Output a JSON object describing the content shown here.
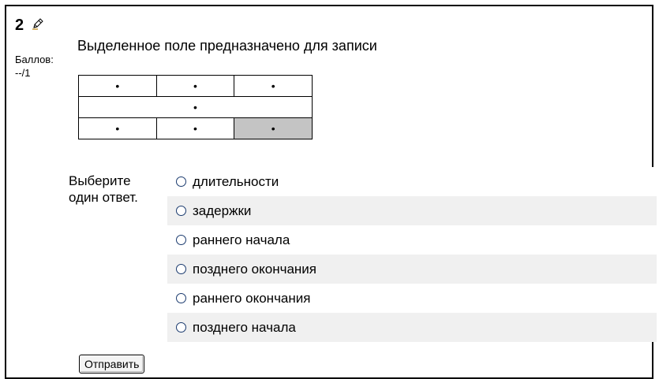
{
  "question": {
    "number": "2",
    "edit_icon": "pencil-edit-icon",
    "grade_label": "Баллов:",
    "grade_value": "--/1",
    "text": "Выделенное поле предназначено для записи"
  },
  "network_table": {
    "rows": [
      [
        "•",
        "•",
        "•"
      ],
      [
        "•"
      ],
      [
        "•",
        "•",
        "•"
      ]
    ],
    "highlighted_cell": "row 3, column 3",
    "highlight_color": "#c4c4c4"
  },
  "answer": {
    "prompt_line1": "Выберите",
    "prompt_line2": "один ответ.",
    "options": [
      "длительности",
      "задержки",
      "раннего начала",
      "позднего окончания",
      "раннего окончания",
      "позднего начала"
    ]
  },
  "submit_label": "Отправить",
  "colors": {
    "alt_row_background": "#f0f0f0",
    "frame_border": "#000000"
  }
}
